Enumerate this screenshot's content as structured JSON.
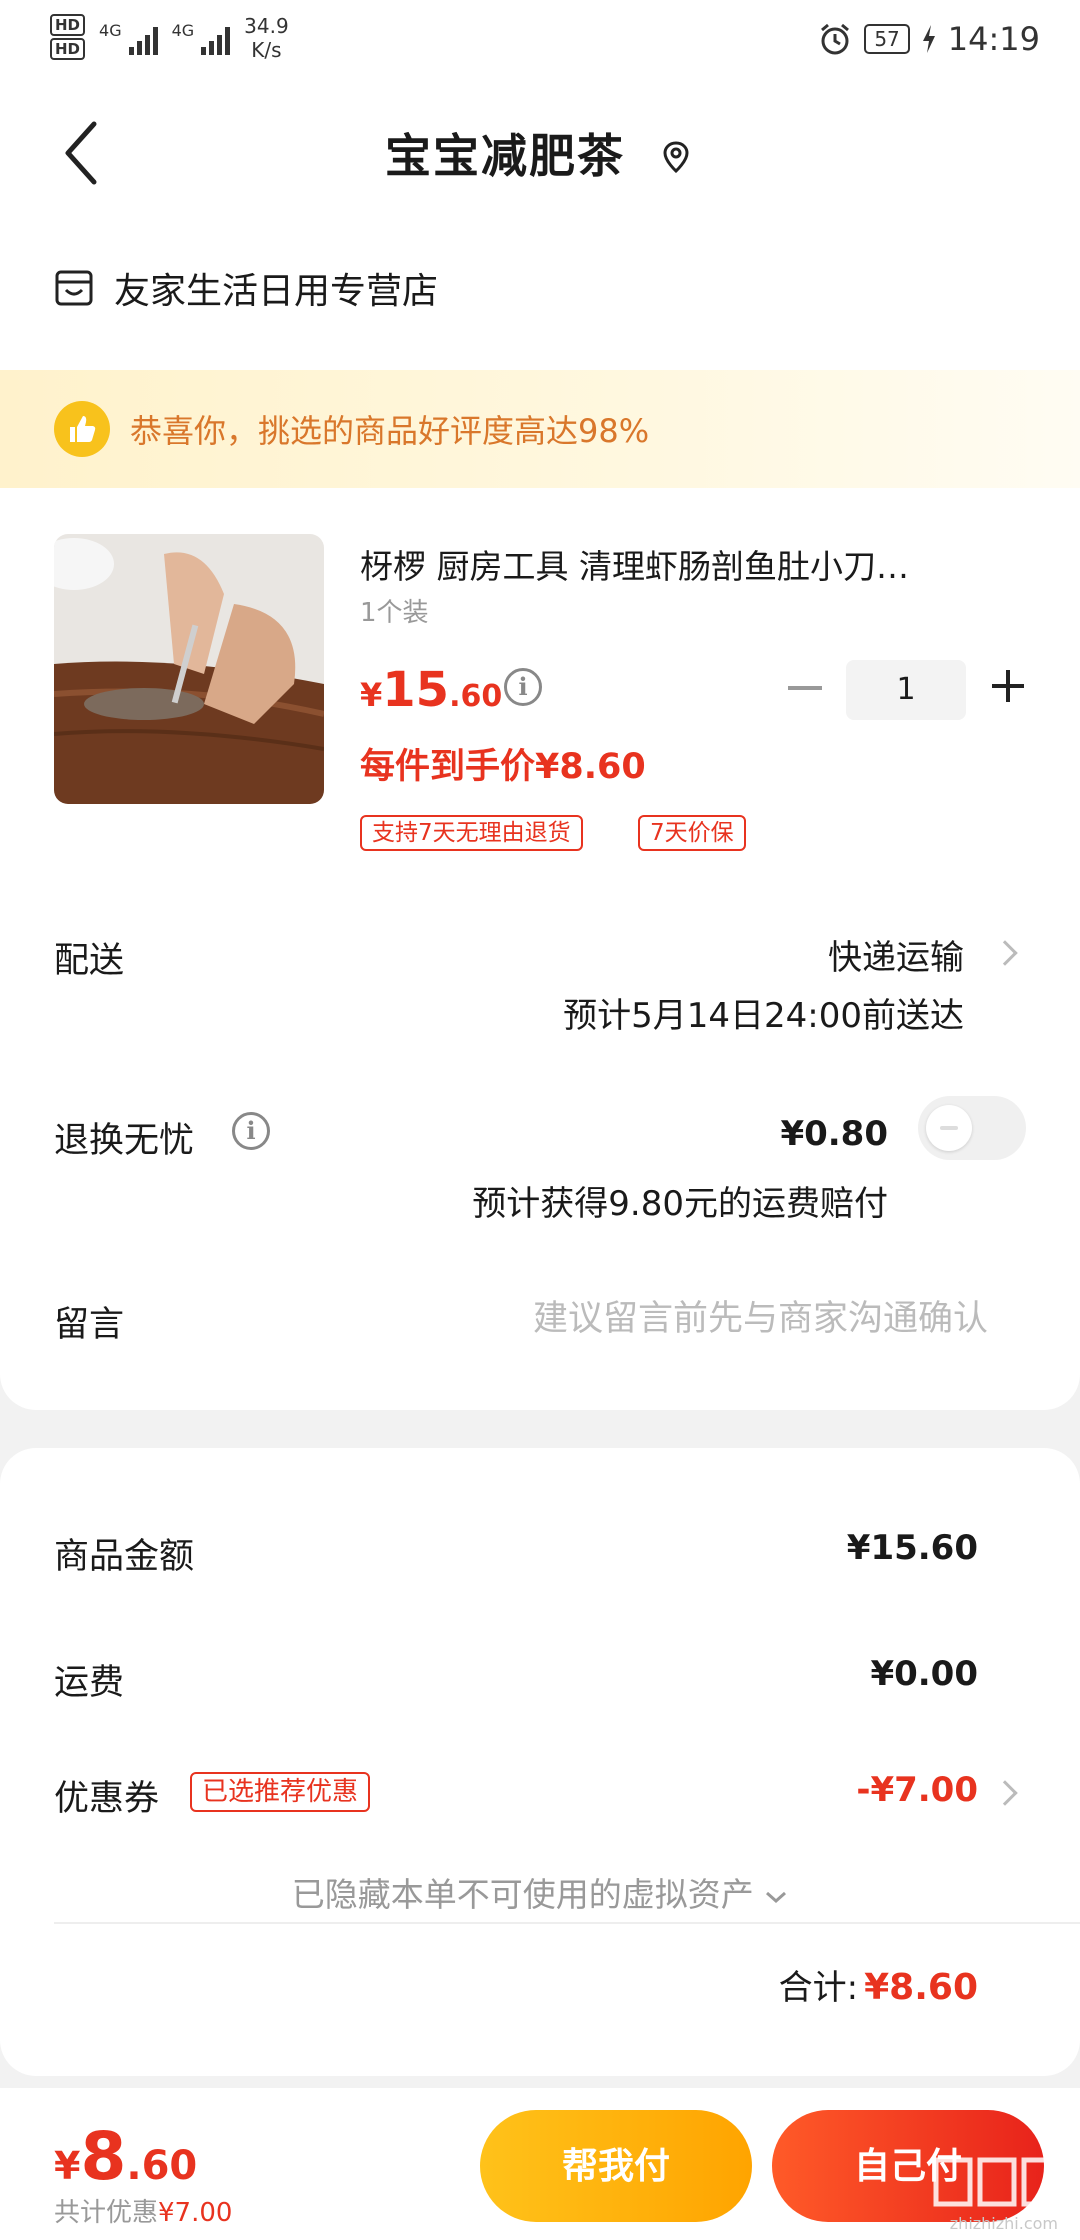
{
  "status_bar": {
    "hd1": "HD",
    "hd2": "HD",
    "net1": "4G",
    "net2": "4G",
    "speed": "34.9",
    "speed_unit": "K/s",
    "battery": "57",
    "time": "14:19"
  },
  "nav": {
    "title": "宝宝减肥茶"
  },
  "store": {
    "name": "友家生活日用专营店"
  },
  "banner": {
    "text": "恭喜你，挑选的商品好评度高达98%"
  },
  "product": {
    "title": "枒椤 厨房工具 清理虾肠剖鱼肚小刀…",
    "sku": "1个装",
    "price_symbol": "¥",
    "price_int": "15",
    "price_dec": ".60",
    "quantity": "1",
    "per_item_price": "每件到手价¥8.60",
    "tags": [
      "支持7天无理由退货",
      "7天价保"
    ]
  },
  "delivery": {
    "label": "配送",
    "method": "快递运输",
    "eta": "预计5月14日24:00前送达"
  },
  "return_insurance": {
    "label": "退换无忧",
    "price": "¥0.80",
    "note": "预计获得9.80元的运费赔付",
    "enabled": false
  },
  "message": {
    "label": "留言",
    "placeholder": "建议留言前先与商家沟通确认"
  },
  "summary": {
    "goods_label": "商品金额",
    "goods_value": "¥15.60",
    "shipping_label": "运费",
    "shipping_value": "¥0.00",
    "coupon_label": "优惠券",
    "coupon_badge": "已选推荐优惠",
    "coupon_value": "-¥7.00",
    "hidden_note": "已隐藏本单不可使用的虚拟资产",
    "total_label": "合计:",
    "total_value": "¥8.60"
  },
  "bottom_bar": {
    "price_symbol": "¥",
    "price_int": "8",
    "price_dec": ".60",
    "saved_label": "共计优惠",
    "saved_value": "¥7.00",
    "help_pay_label": "帮我付",
    "self_pay_label": "自己付"
  },
  "watermark": {
    "domain": "zhizhizhi.com"
  },
  "colors": {
    "accent_red": "#e8331f",
    "accent_yellow": "#ffb400",
    "banner_text": "#d9772b"
  }
}
